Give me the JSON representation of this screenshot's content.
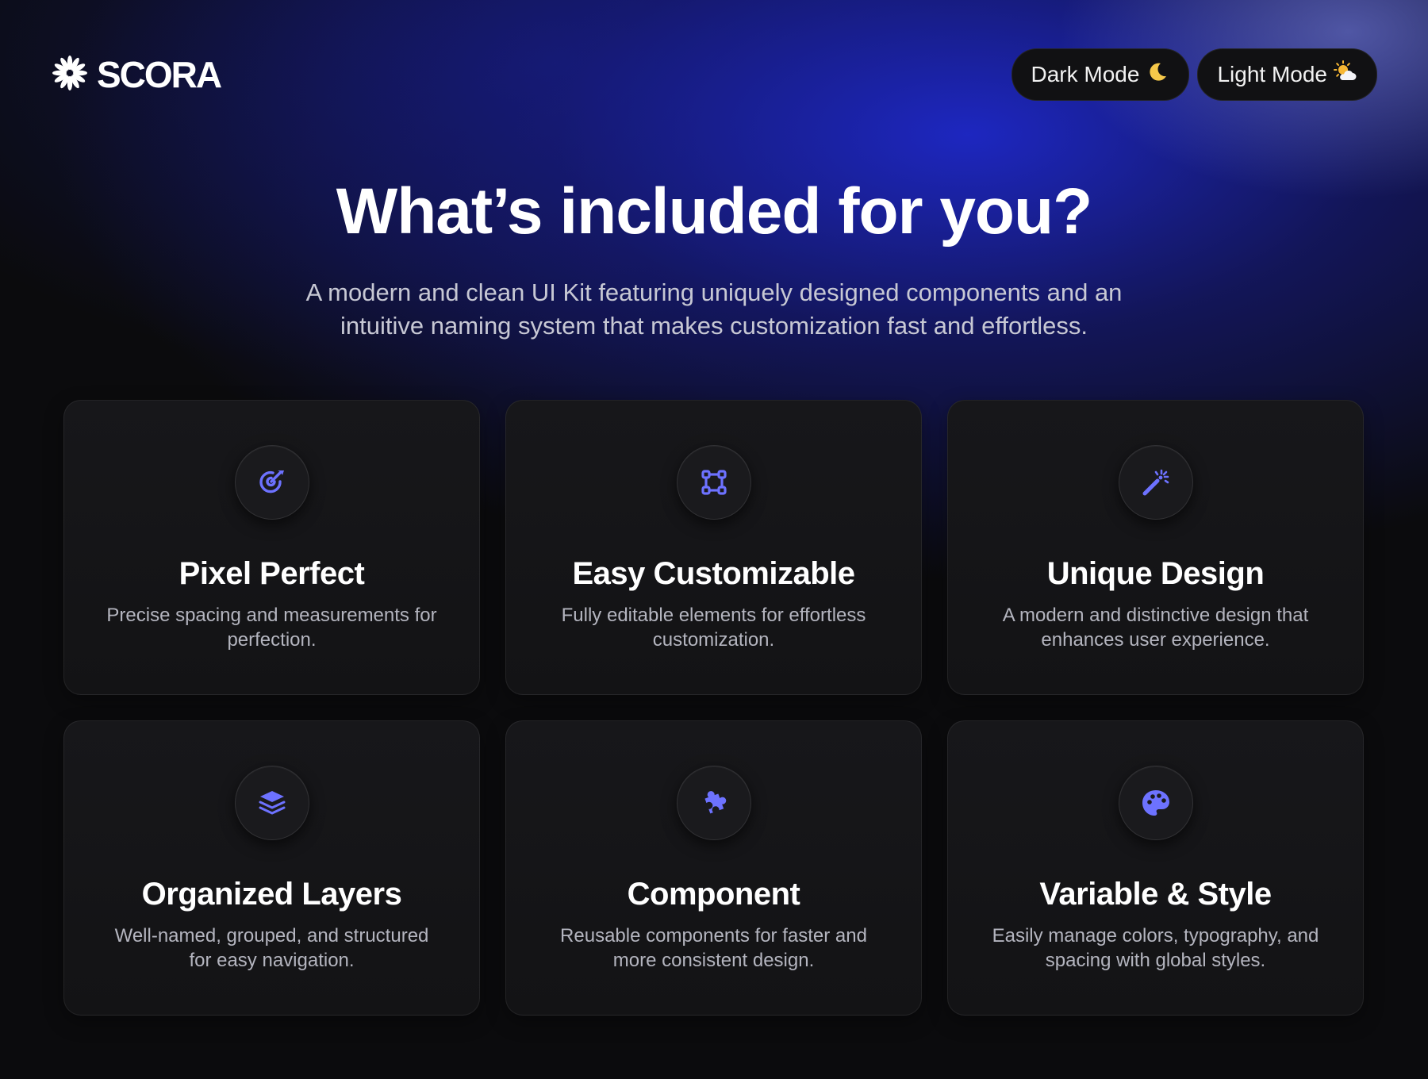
{
  "brand": {
    "logo_icon": "asterisk-flower-icon",
    "name": "SCORA"
  },
  "theme_toggle": {
    "dark": {
      "label": "Dark Mode",
      "icon": "moon-icon"
    },
    "light": {
      "label": "Light Mode",
      "icon": "sun-cloud-icon"
    }
  },
  "hero": {
    "title": "What’s included for you?",
    "subtitle": "A modern and clean UI Kit featuring uniquely designed components and an intuitive naming system that makes customization fast and effortless."
  },
  "accent_color": "#6d72ff",
  "features": [
    {
      "icon": "target-arrow-icon",
      "title": "Pixel Perfect",
      "description": "Precise spacing and measurements for perfection."
    },
    {
      "icon": "vector-square-icon",
      "title": "Easy Customizable",
      "description": "Fully editable elements for effortless customization."
    },
    {
      "icon": "magic-wand-icon",
      "title": "Unique Design",
      "description": "A modern and distinctive design that enhances user experience."
    },
    {
      "icon": "layers-icon",
      "title": "Organized Layers",
      "description": "Well-named, grouped, and structured for easy navigation."
    },
    {
      "icon": "puzzle-piece-icon",
      "title": "Component",
      "description": "Reusable components for faster and more consistent design."
    },
    {
      "icon": "palette-icon",
      "title": "Variable & Style",
      "description": "Easily manage colors, typography, and spacing with global styles."
    }
  ]
}
